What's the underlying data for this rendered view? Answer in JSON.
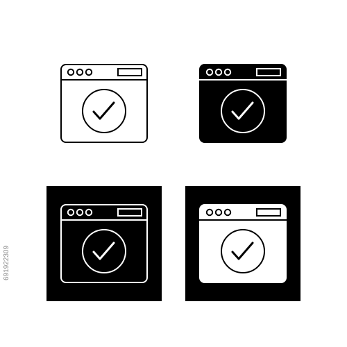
{
  "colors": {
    "background": "#ffffff",
    "ink": "#000000",
    "paper": "#ffffff",
    "watermark_text": "#8a8a8a"
  },
  "icons": [
    {
      "name": "browser-window-check-outline-icon",
      "style": "outline"
    },
    {
      "name": "browser-window-check-filled-icon",
      "style": "glyph"
    },
    {
      "name": "browser-window-check-inverse-outline-icon",
      "style": "outline on black square"
    },
    {
      "name": "browser-window-check-inverse-filled-icon",
      "style": "glyph on black square"
    }
  ],
  "watermark": {
    "stock_id": "691922309"
  }
}
